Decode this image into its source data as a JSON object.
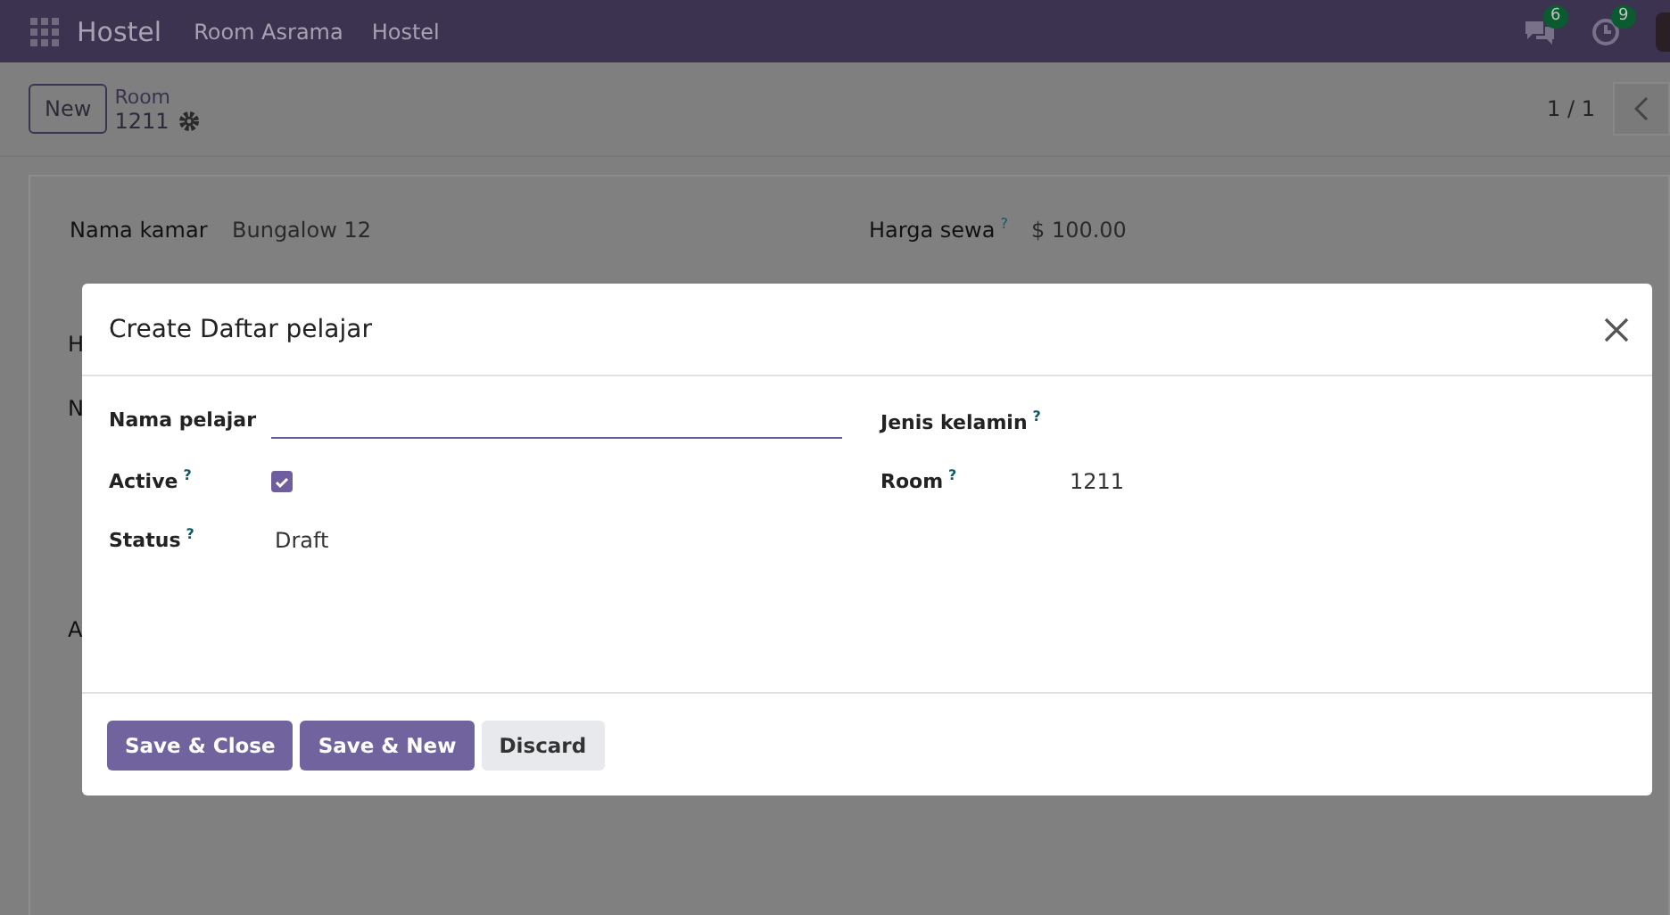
{
  "navbar": {
    "app_name": "Hostel",
    "menu": [
      "Room Asrama",
      "Hostel"
    ],
    "messages_count": "6",
    "activities_count": "9"
  },
  "control_panel": {
    "new_button": "New",
    "breadcrumb": "Room",
    "record": "1211",
    "pager": "1 / 1"
  },
  "form": {
    "fields": [
      {
        "label": "Nama kamar",
        "value": "Bungalow 12"
      },
      {
        "label": "Harga sewa",
        "help": "?",
        "value": "$ 100.00"
      }
    ],
    "hidden_labels": [
      "H",
      "N",
      "A"
    ]
  },
  "dialog": {
    "title": "Create Daftar pelajar",
    "left_fields": [
      {
        "kind": "input",
        "label": "Nama pelajar"
      },
      {
        "kind": "checkbox",
        "label": "Active",
        "help": "?",
        "checked": true
      },
      {
        "kind": "text",
        "label": "Status",
        "help": "?",
        "value": "Draft"
      }
    ],
    "right_fields": [
      {
        "kind": "text",
        "label": "Jenis kelamin",
        "help": "?"
      },
      {
        "kind": "text",
        "label": "Room",
        "help": "?",
        "value": "1211"
      }
    ],
    "buttons": [
      {
        "label": "Save & Close",
        "primary": true
      },
      {
        "label": "Save & New",
        "primary": true
      },
      {
        "label": "Discard",
        "primary": false
      }
    ]
  }
}
